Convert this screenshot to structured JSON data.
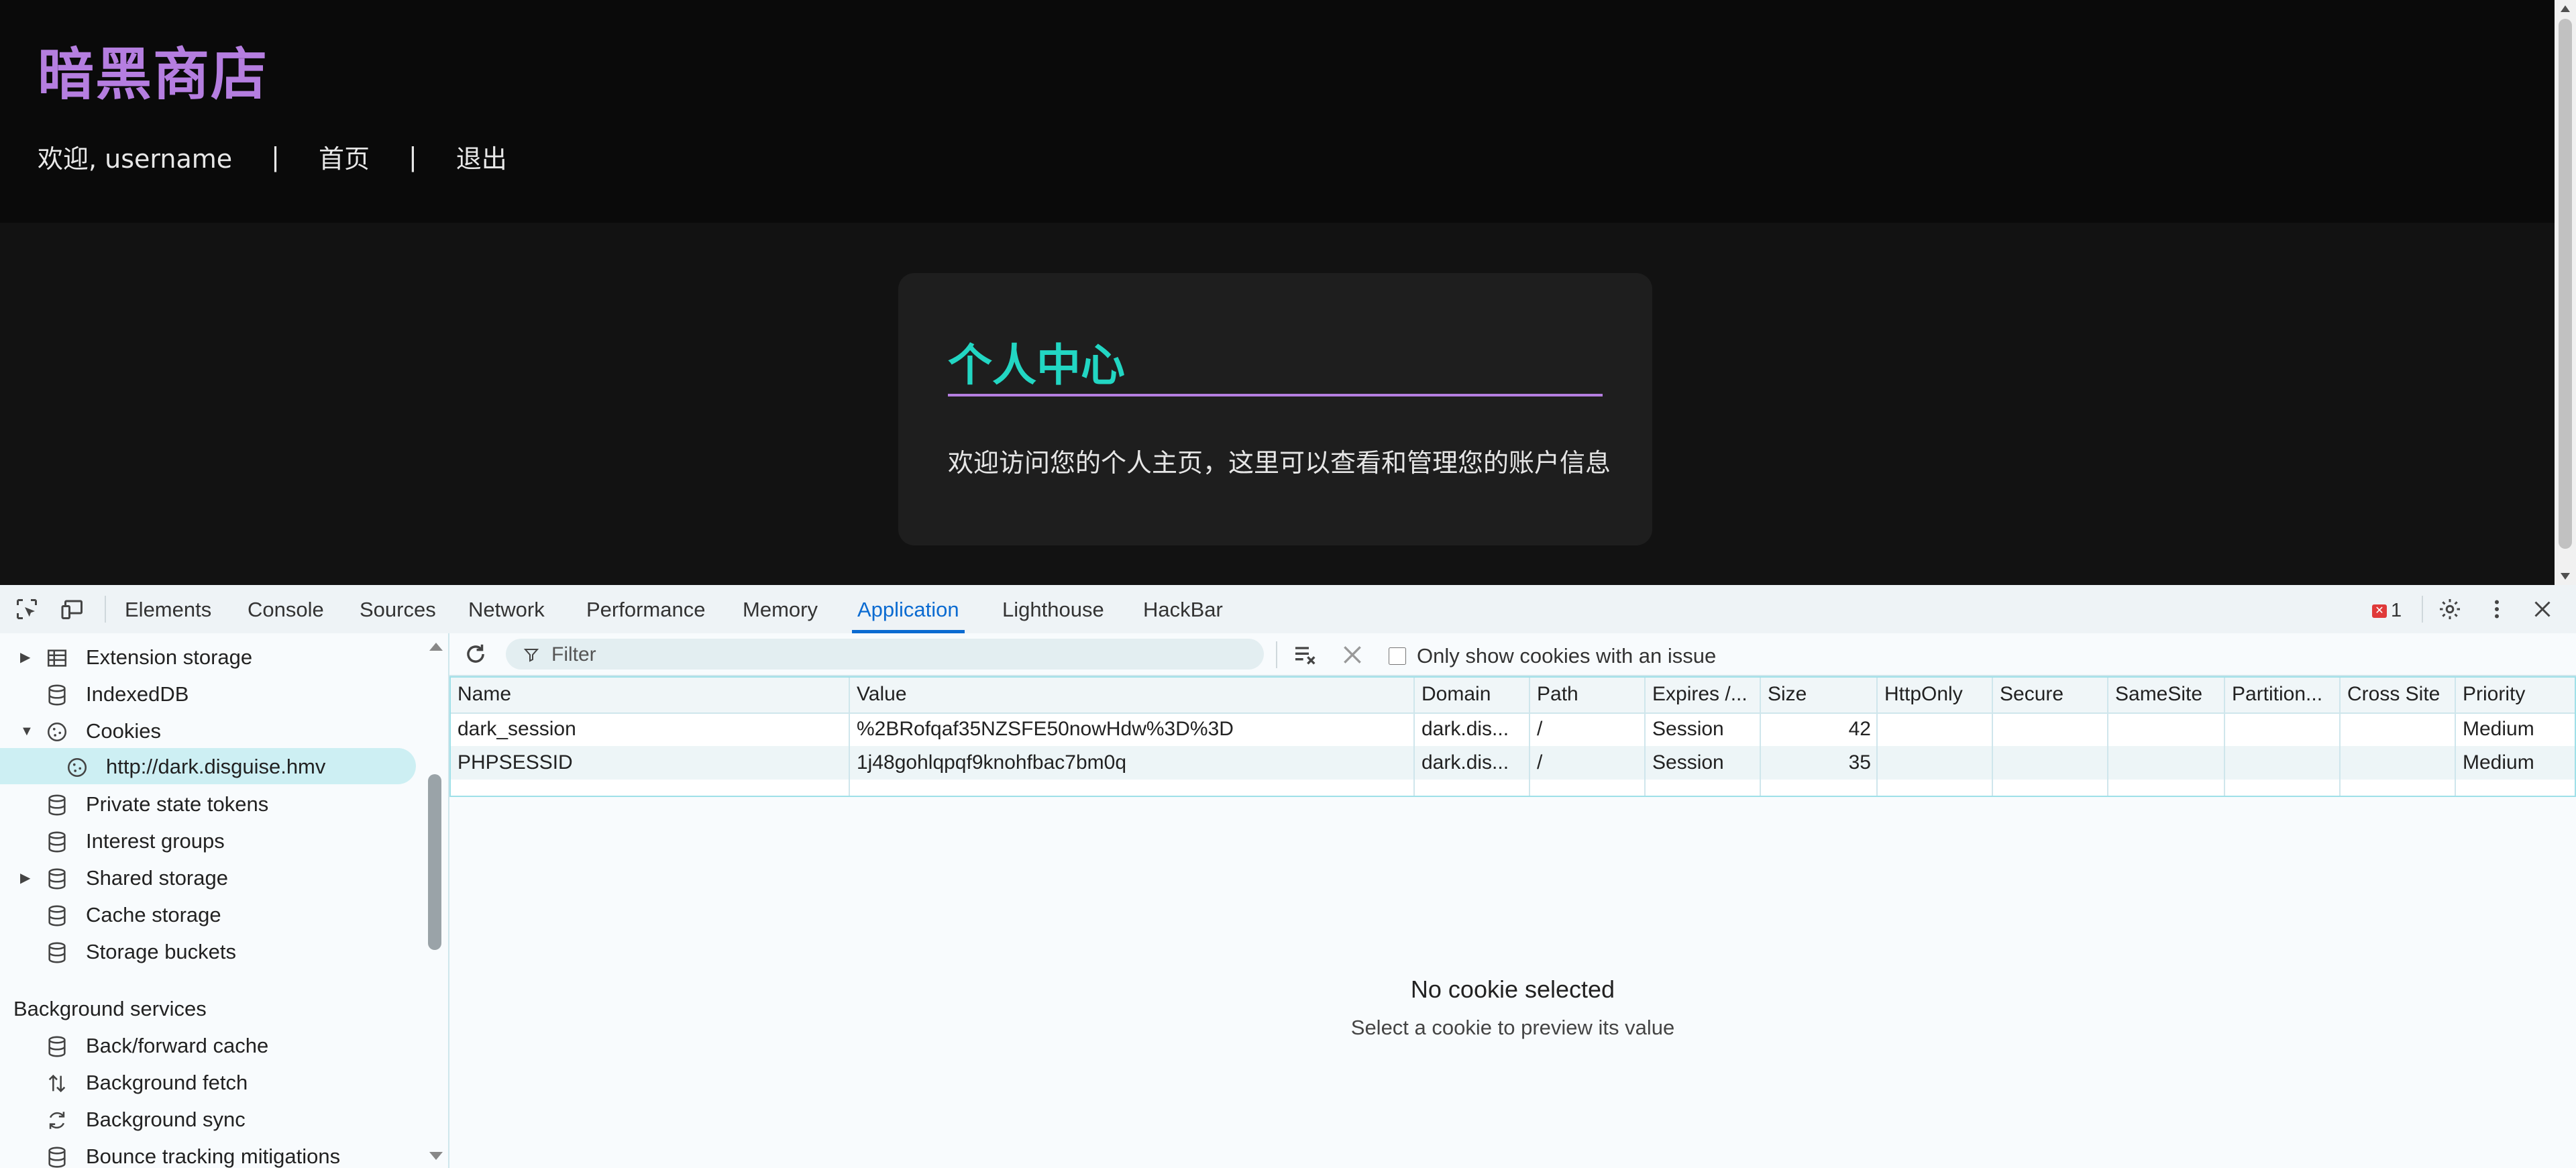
{
  "site": {
    "title": "暗黑商店",
    "nav": {
      "welcome": "欢迎, username",
      "sep": "|",
      "home": "首页",
      "logout": "退出"
    },
    "card": {
      "heading": "个人中心",
      "text": "欢迎访问您的个人主页，这里可以查看和管理您的账户信息"
    }
  },
  "devtools": {
    "tabs": [
      "Elements",
      "Console",
      "Sources",
      "Network",
      "Performance",
      "Memory",
      "Application",
      "Lighthouse",
      "HackBar"
    ],
    "active_tab": "Application",
    "error_count": "1",
    "sidebar": {
      "items": [
        {
          "label": "Extension storage",
          "icon": "table-icon",
          "expandable": true
        },
        {
          "label": "IndexedDB",
          "icon": "database-icon",
          "expandable": false
        },
        {
          "label": "Cookies",
          "icon": "cookie-icon",
          "expandable": true,
          "expanded": true
        },
        {
          "label": "http://dark.disguise.hmv",
          "icon": "cookie-icon",
          "selected": true
        },
        {
          "label": "Private state tokens",
          "icon": "database-icon"
        },
        {
          "label": "Interest groups",
          "icon": "database-icon"
        },
        {
          "label": "Shared storage",
          "icon": "database-icon",
          "expandable": true
        },
        {
          "label": "Cache storage",
          "icon": "database-icon"
        },
        {
          "label": "Storage buckets",
          "icon": "database-icon"
        }
      ],
      "section": "Background services",
      "services": [
        {
          "label": "Back/forward cache",
          "icon": "database-icon"
        },
        {
          "label": "Background fetch",
          "icon": "updown-arrows-icon"
        },
        {
          "label": "Background sync",
          "icon": "sync-icon"
        },
        {
          "label": "Bounce tracking mitigations",
          "icon": "database-icon"
        }
      ]
    },
    "toolbar": {
      "filter_placeholder": "Filter",
      "only_issues_label": "Only show cookies with an issue"
    },
    "cookies": {
      "columns": [
        "Name",
        "Value",
        "Domain",
        "Path",
        "Expires /...",
        "Size",
        "HttpOnly",
        "Secure",
        "SameSite",
        "Partition...",
        "Cross Site",
        "Priority"
      ],
      "rows": [
        {
          "name": "dark_session",
          "value": "%2BRofqaf35NZSFE50nowHdw%3D%3D",
          "domain": "dark.dis...",
          "path": "/",
          "expires": "Session",
          "size": "42",
          "httponly": "",
          "secure": "",
          "samesite": "",
          "partition": "",
          "crosssite": "",
          "priority": "Medium"
        },
        {
          "name": "PHPSESSID",
          "value": "1j48gohlqpqf9knohfbac7bm0q",
          "domain": "dark.dis...",
          "path": "/",
          "expires": "Session",
          "size": "35",
          "httponly": "",
          "secure": "",
          "samesite": "",
          "partition": "",
          "crosssite": "",
          "priority": "Medium"
        }
      ]
    },
    "empty": {
      "title": "No cookie selected",
      "subtitle": "Select a cookie to preview its value"
    }
  }
}
